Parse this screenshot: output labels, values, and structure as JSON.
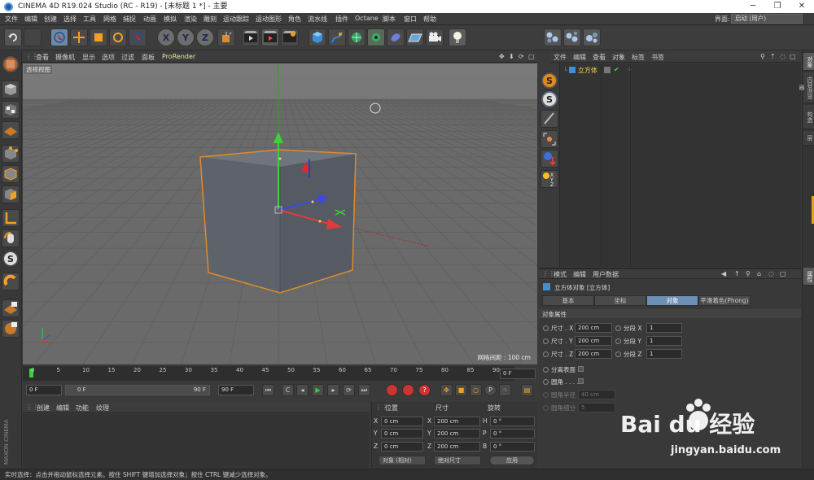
{
  "window": {
    "title": "CINEMA 4D R19.024 Studio (RC - R19) - [未标题 1 *] - 主要",
    "minimize": "─",
    "maximize": "❐",
    "close": "✕"
  },
  "menubar": {
    "items": [
      "文件",
      "编辑",
      "创建",
      "选择",
      "工具",
      "网格",
      "捕捉",
      "动画",
      "模拟",
      "渲染",
      "雕刻",
      "运动跟踪",
      "运动图形",
      "角色",
      "流水线",
      "插件",
      "Octane",
      "脚本",
      "窗口",
      "帮助"
    ],
    "layout_label": "界面:",
    "layout_value": "启动 (用户)"
  },
  "toolbar": {
    "axis_x": "X",
    "axis_y": "Y",
    "axis_z": "Z"
  },
  "viewport": {
    "menu": [
      "查看",
      "摄像机",
      "显示",
      "选项",
      "过滤",
      "面板",
      "ProRender"
    ],
    "view_label": "透视视图",
    "grid_label": "网格间距 : 100 cm",
    "colors": {
      "background": "#6e6e6e",
      "cube": "#5c616a",
      "selection": "#e08a2c"
    }
  },
  "timeline": {
    "ticks": [
      "0",
      "5",
      "10",
      "15",
      "20",
      "25",
      "30",
      "35",
      "40",
      "45",
      "50",
      "55",
      "60",
      "65",
      "70",
      "75",
      "80",
      "85",
      "90"
    ],
    "end_frame": "0 F",
    "start_field": "0 F",
    "current_field": "0 F",
    "max_field": "90 F",
    "end_field": "90 F"
  },
  "material": {
    "menu": [
      "创建",
      "编辑",
      "功能",
      "纹理"
    ]
  },
  "coordinates": {
    "headers": [
      "位置",
      "尺寸",
      "旋转"
    ],
    "rows": [
      {
        "pos_axis": "X",
        "pos": "0 cm",
        "size_axis": "X",
        "size": "200 cm",
        "rot_axis": "H",
        "rot": "0 °"
      },
      {
        "pos_axis": "Y",
        "pos": "0 cm",
        "size_axis": "Y",
        "size": "200 cm",
        "rot_axis": "P",
        "rot": "0 °"
      },
      {
        "pos_axis": "Z",
        "pos": "0 cm",
        "size_axis": "Z",
        "size": "200 cm",
        "rot_axis": "B",
        "rot": "0 °"
      }
    ],
    "mode_dropdown": "对象 (相对)",
    "size_dropdown": "绝对尺寸",
    "apply_button": "应用"
  },
  "object_manager": {
    "menu": [
      "文件",
      "编辑",
      "查看",
      "对象",
      "标签",
      "书签"
    ],
    "object_name": "立方体"
  },
  "right_tabs": [
    "对象",
    "内容浏览器",
    "构造",
    "层"
  ],
  "attribute_tabs_right": [
    "属性"
  ],
  "attributes": {
    "menu": [
      "模式",
      "编辑",
      "用户数据"
    ],
    "object_title": "立方体对象 [立方体]",
    "tabs": [
      "基本",
      "坐标",
      "对象",
      "平滑着色(Phong)"
    ],
    "active_tab": "对象",
    "section": "对象属性",
    "size_x_label": "尺寸 . X",
    "size_x": "200 cm",
    "size_y_label": "尺寸 . Y",
    "size_y": "200 cm",
    "size_z_label": "尺寸 . Z",
    "size_z": "200 cm",
    "seg_x_label": "分段 X",
    "seg_x": "1",
    "seg_y_label": "分段 Y",
    "seg_y": "1",
    "seg_z_label": "分段 Z",
    "seg_z": "1",
    "separate_label": "分离表面",
    "fillet_label": "圆角 . . . .",
    "fillet_radius_label": "圆角半径",
    "fillet_radius": "40 cm",
    "fillet_sub_label": "圆角细分",
    "fillet_sub": "5"
  },
  "brand": "MAXON CINEMA 4D",
  "status": {
    "text": "实时选择：点击并拖动鼠标选择元素。按住 SHIFT 键增加选择对象；按住 CTRL 键减少选择对象。"
  },
  "watermark": {
    "brand": "Bai du 经验",
    "url": "jingyan.baidu.com"
  }
}
